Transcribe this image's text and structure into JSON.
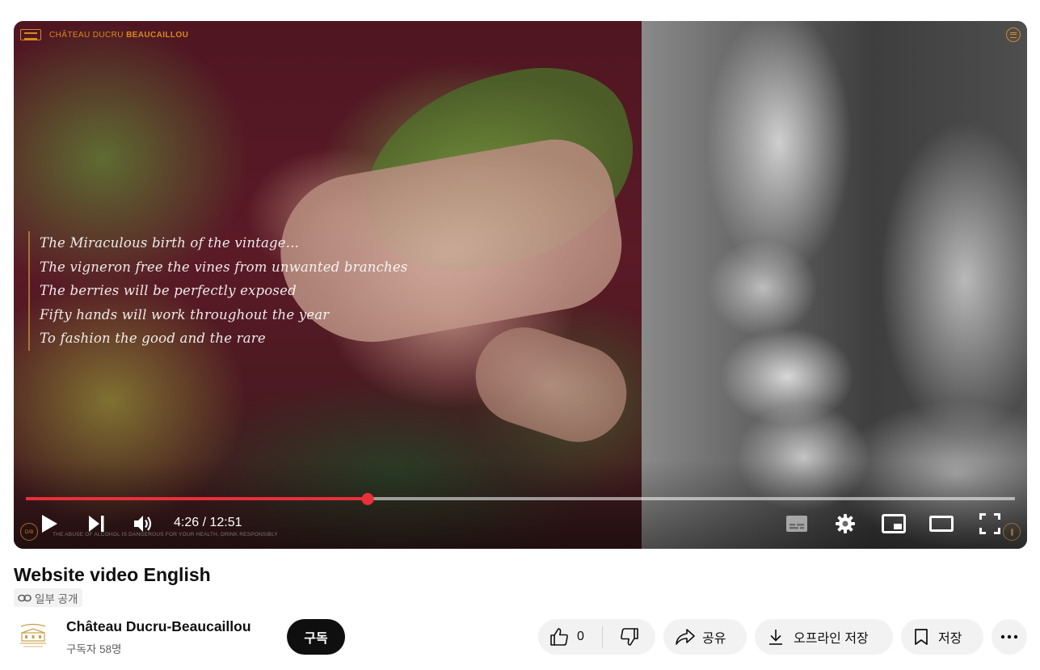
{
  "player": {
    "brand_prefix": "CHÂTEAU DUCRU",
    "brand_suffix": "BEAUCAILLOU",
    "poem_lines": [
      "The Miraculous birth of the vintage...",
      "The vigneron free the vines from unwanted branches",
      "The berries will be perfectly exposed",
      "Fifty hands will work throughout the year",
      "To fashion the good and the rare"
    ],
    "warning": "THE ABUSE OF ALCOHOL IS DANGEROUS FOR YOUR HEALTH, DRINK RESPONSIBLY",
    "badge_text": "D/B",
    "current_time": "4:26",
    "duration": "12:51",
    "time_display": "4:26 / 12:51",
    "progress_fraction": 0.3454,
    "accent_color": "#e8303a",
    "brand_color": "#d88a1e"
  },
  "video": {
    "title": "Website video English",
    "visibility": "일부 공개"
  },
  "channel": {
    "name": "Château Ducru-Beaucaillou",
    "subscribers": "구독자 58명",
    "subscribe_label": "구독"
  },
  "actions": {
    "like_count": "0",
    "share_label": "공유",
    "offline_label": "오프라인 저장",
    "save_label": "저장"
  },
  "icons": [
    "play-icon",
    "next-icon",
    "volume-icon",
    "subtitles-icon",
    "settings-icon",
    "miniplayer-icon",
    "theater-mode-icon",
    "fullscreen-icon",
    "link-icon",
    "thumbs-up-icon",
    "thumbs-down-icon",
    "share-icon",
    "download-icon",
    "bookmark-icon",
    "more-icon"
  ]
}
